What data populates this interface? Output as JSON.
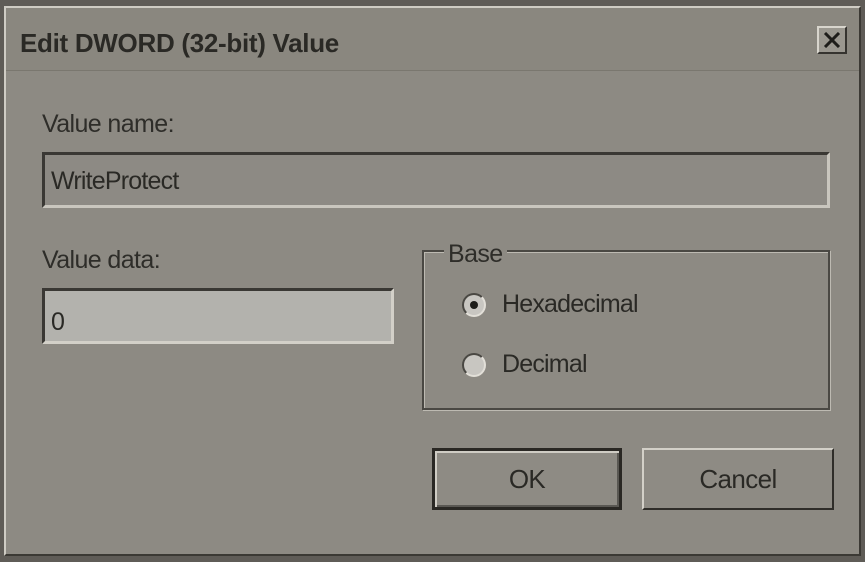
{
  "dialog": {
    "title": "Edit DWORD (32-bit) Value",
    "close_icon": "close-icon"
  },
  "value_name": {
    "label": "Value name:",
    "value": "WriteProtect"
  },
  "value_data": {
    "label": "Value data:",
    "value": "0"
  },
  "base": {
    "legend": "Base",
    "options": [
      {
        "label": "Hexadecimal",
        "selected": true
      },
      {
        "label": "Decimal",
        "selected": false
      }
    ]
  },
  "buttons": {
    "ok_label": "OK",
    "cancel_label": "Cancel"
  }
}
